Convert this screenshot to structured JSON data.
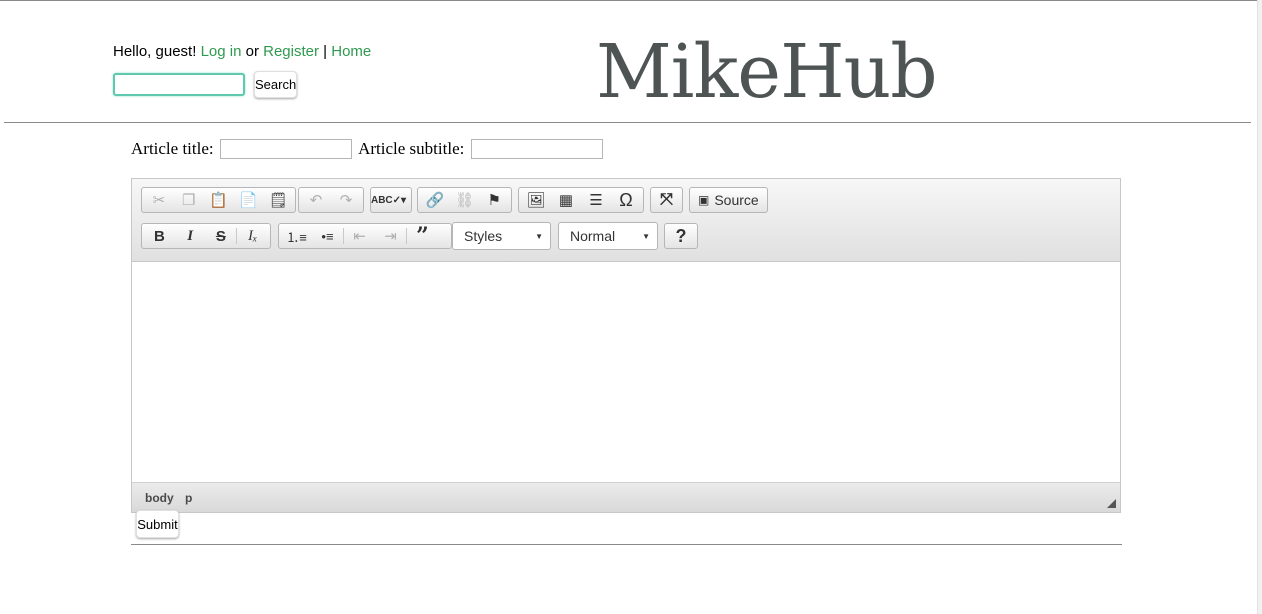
{
  "header": {
    "greeting": "Hello, guest!",
    "login_link": "Log in",
    "or_text": "or",
    "register_link": "Register",
    "separator": "|",
    "home_link": "Home",
    "search_value": "",
    "search_button": "Search",
    "logo": "MikeHub"
  },
  "form": {
    "title_label": "Article title:",
    "title_value": "",
    "subtitle_label": "Article subtitle:",
    "subtitle_value": "",
    "submit_label": "Submit"
  },
  "editor": {
    "toolbar_row1": {
      "clipboard": [
        "cut-icon",
        "copy-icon",
        "paste-icon",
        "paste-text-icon",
        "paste-word-icon"
      ],
      "history": [
        "undo-icon",
        "redo-icon"
      ],
      "spellcheck": "spellcheck-icon",
      "links": [
        "link-icon",
        "unlink-icon",
        "anchor-icon"
      ],
      "insert": [
        "image-icon",
        "table-icon",
        "horizontal-line-icon",
        "special-char-icon"
      ],
      "maximize": "maximize-icon",
      "source_label": "Source"
    },
    "toolbar_row2": {
      "basic": [
        "bold-icon",
        "italic-icon",
        "strike-icon",
        "remove-format-icon"
      ],
      "lists": [
        "numbered-list-icon",
        "bulleted-list-icon",
        "outdent-icon",
        "indent-icon",
        "blockquote-icon"
      ],
      "styles_combo": "Styles",
      "format_combo": "Normal",
      "help": "?"
    },
    "status_path": [
      "body",
      "p"
    ]
  },
  "colors": {
    "link": "#2f9a4f",
    "logo": "#4e5353",
    "focus_border": "#5fc8ae"
  }
}
